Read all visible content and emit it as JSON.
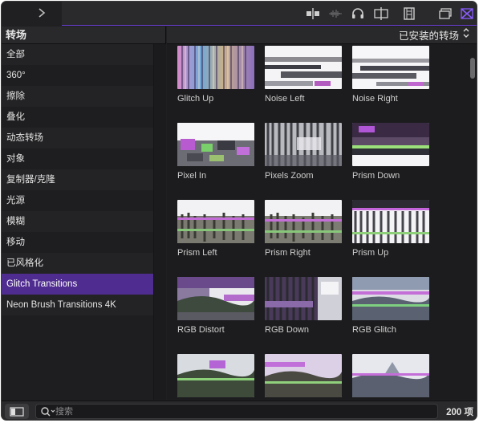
{
  "toolbar": {
    "icons": [
      "forward-chevron-icon",
      "clip-appearance-icon",
      "audio-waveform-icon",
      "headphones-icon",
      "skimming-icon",
      "filmstrip-icon",
      "browser-window-icon",
      "transitions-icon"
    ],
    "accent_color": "#6b3fd6"
  },
  "sidebar": {
    "title": "转场",
    "items": [
      {
        "label": "全部"
      },
      {
        "label": "360°"
      },
      {
        "label": "擦除"
      },
      {
        "label": "叠化"
      },
      {
        "label": "动态转场"
      },
      {
        "label": "对象"
      },
      {
        "label": "复制器/克隆"
      },
      {
        "label": "光源"
      },
      {
        "label": "模糊"
      },
      {
        "label": "移动"
      },
      {
        "label": "已风格化"
      },
      {
        "label": "Glitch Transitions",
        "selected": true
      },
      {
        "label": "Neon Brush Transitions 4K"
      }
    ],
    "selected_color": "#4f2c8f"
  },
  "content": {
    "filter_label": "已安装的转场",
    "items": [
      {
        "name": "Glitch Up"
      },
      {
        "name": "Noise Left"
      },
      {
        "name": "Noise Right"
      },
      {
        "name": "Pixel In"
      },
      {
        "name": "Pixels Zoom"
      },
      {
        "name": "Prism Down"
      },
      {
        "name": "Prism Left"
      },
      {
        "name": "Prism Right"
      },
      {
        "name": "Prism Up"
      },
      {
        "name": "RGB Distort"
      },
      {
        "name": "RGB Down"
      },
      {
        "name": "RGB Glitch"
      },
      {
        "name": ""
      },
      {
        "name": ""
      },
      {
        "name": ""
      }
    ]
  },
  "bottom": {
    "search_placeholder": "搜索",
    "search_value": "",
    "count": "200 项"
  }
}
